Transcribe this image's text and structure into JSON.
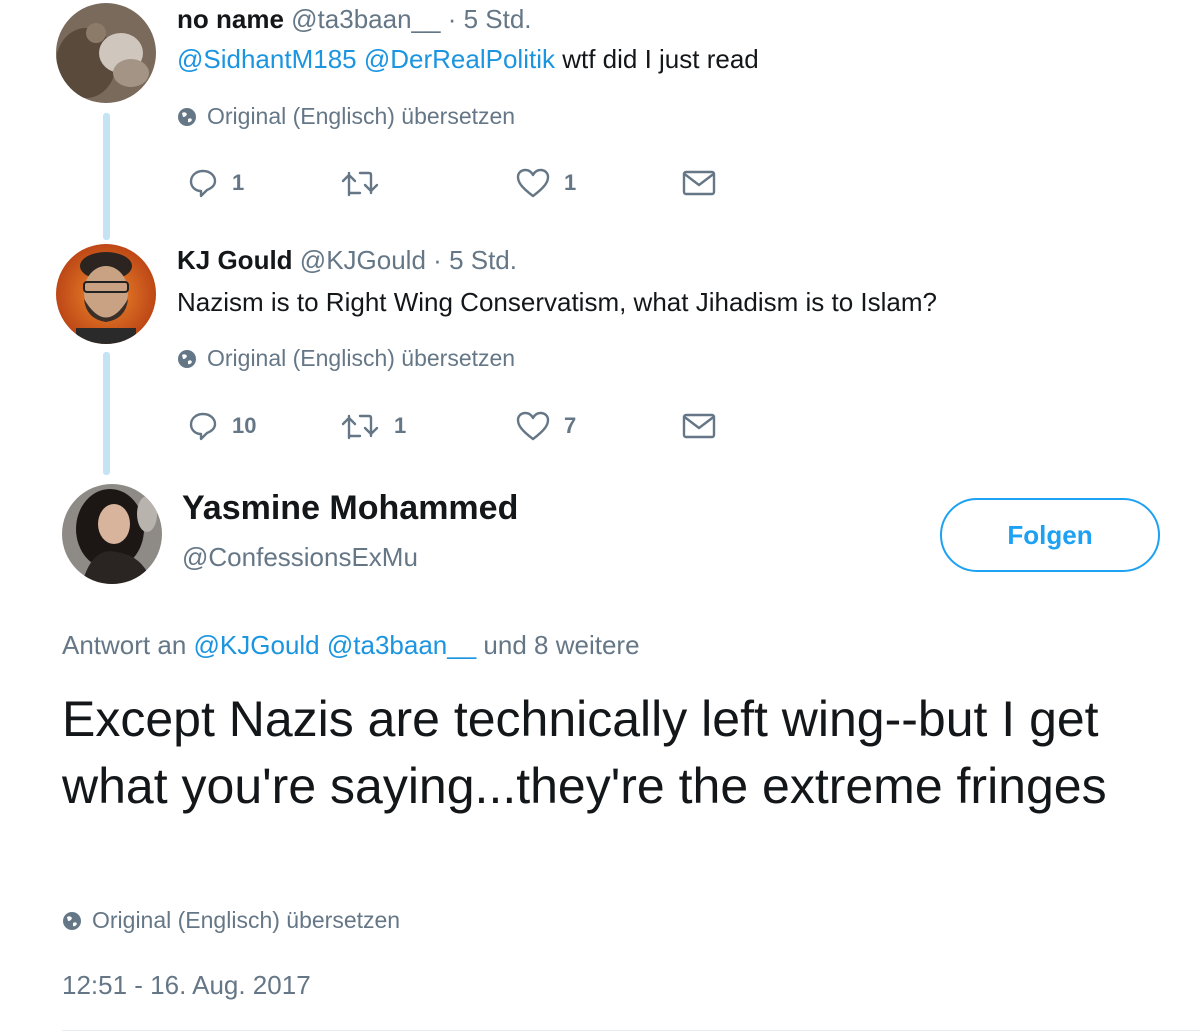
{
  "tweets": [
    {
      "name": "no name",
      "handle": "@ta3baan__",
      "separator": "·",
      "time": "5 Std.",
      "mentions": [
        "@SidhantM185",
        "@DerRealPolitik"
      ],
      "text": "wtf did I just read",
      "translate_label": "Original (Englisch) übersetzen",
      "reply_count": "1",
      "retweet_count": "",
      "like_count": "1"
    },
    {
      "name": "KJ Gould",
      "handle": "@KJGould",
      "separator": "·",
      "time": "5 Std.",
      "text": "Nazism is to Right Wing Conservatism, what Jihadism is to Islam?",
      "translate_label": "Original (Englisch) übersetzen",
      "reply_count": "10",
      "retweet_count": "1",
      "like_count": "7"
    }
  ],
  "main_tweet": {
    "name": "Yasmine Mohammed",
    "handle": "@ConfessionsExMu",
    "follow_label": "Folgen",
    "reply_prefix": "Antwort an",
    "reply_mentions": [
      "@KJGould",
      "@ta3baan__"
    ],
    "reply_suffix": "und 8 weitere",
    "text": "Except Nazis are technically left wing--but I get what you're saying...they're the extreme fringes",
    "translate_label": "Original (Englisch) übersetzen",
    "timestamp": "12:51 - 16. Aug. 2017"
  },
  "colors": {
    "accent": "#1da1f2",
    "mention": "#1b95e0",
    "secondary_text": "#657786",
    "thread_line": "#c4e3f5"
  },
  "icons": [
    "reply-icon",
    "retweet-icon",
    "like-icon",
    "message-icon",
    "globe-icon"
  ]
}
